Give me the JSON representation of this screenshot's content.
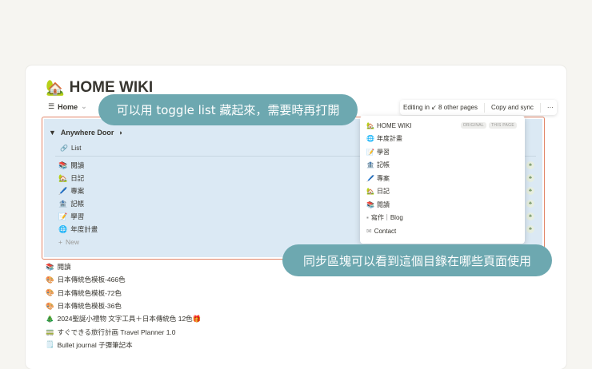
{
  "page": {
    "title": "HOME WIKI",
    "title_icon": "🏡",
    "home_tab": "Home"
  },
  "toggle": {
    "label": "Anywhere Door",
    "list_label": "List",
    "items": [
      {
        "icon": "📚",
        "label": "閱讀"
      },
      {
        "icon": "🏡",
        "label": "日記"
      },
      {
        "icon": "🖊️",
        "label": "專案"
      },
      {
        "icon": "🏦",
        "label": "記帳"
      },
      {
        "icon": "📝",
        "label": "學習"
      },
      {
        "icon": "🌐",
        "label": "年度計畫"
      }
    ],
    "new_label": "New"
  },
  "toolbar": {
    "editing": "Editing in ↙ 8 other pages",
    "copy_sync": "Copy and sync",
    "more": "···"
  },
  "popup": {
    "items": [
      {
        "icon": "🏡",
        "label": "HOME WIKI",
        "badges": [
          "ORIGINAL",
          "THIS PAGE"
        ]
      },
      {
        "icon": "🌐",
        "label": "年度計畫"
      },
      {
        "icon": "📝",
        "label": "學習"
      },
      {
        "icon": "🏦",
        "label": "記帳"
      },
      {
        "icon": "🖊️",
        "label": "專案"
      },
      {
        "icon": "🏡",
        "label": "日記"
      },
      {
        "icon": "📚",
        "label": "閱讀"
      },
      {
        "icon": "▪",
        "label": "寫作｜Blog"
      },
      {
        "icon": "✉",
        "label": "Contact"
      }
    ]
  },
  "callouts": {
    "top": "可以用 toggle list 藏起來，需要時再打開",
    "bottom": "同步區塊可以看到這個目錄在哪些頁面使用"
  },
  "below": [
    {
      "icon": "📚",
      "label": "閱讀"
    },
    {
      "icon": "🎨",
      "label": "日本傳統色模板-466色"
    },
    {
      "icon": "🎨",
      "label": "日本傳統色模板-72色"
    },
    {
      "icon": "🎨",
      "label": "日本傳統色模板-36色"
    },
    {
      "icon": "🎄",
      "label": "2024聖誕小禮物 文字工具＋日本傳統色 12色🎁"
    },
    {
      "icon": "🚃",
      "label": "すぐできる旅行計画 Travel Planner 1.0"
    },
    {
      "icon": "🗒️",
      "label": "Bullet journal 子彈筆記本"
    }
  ]
}
